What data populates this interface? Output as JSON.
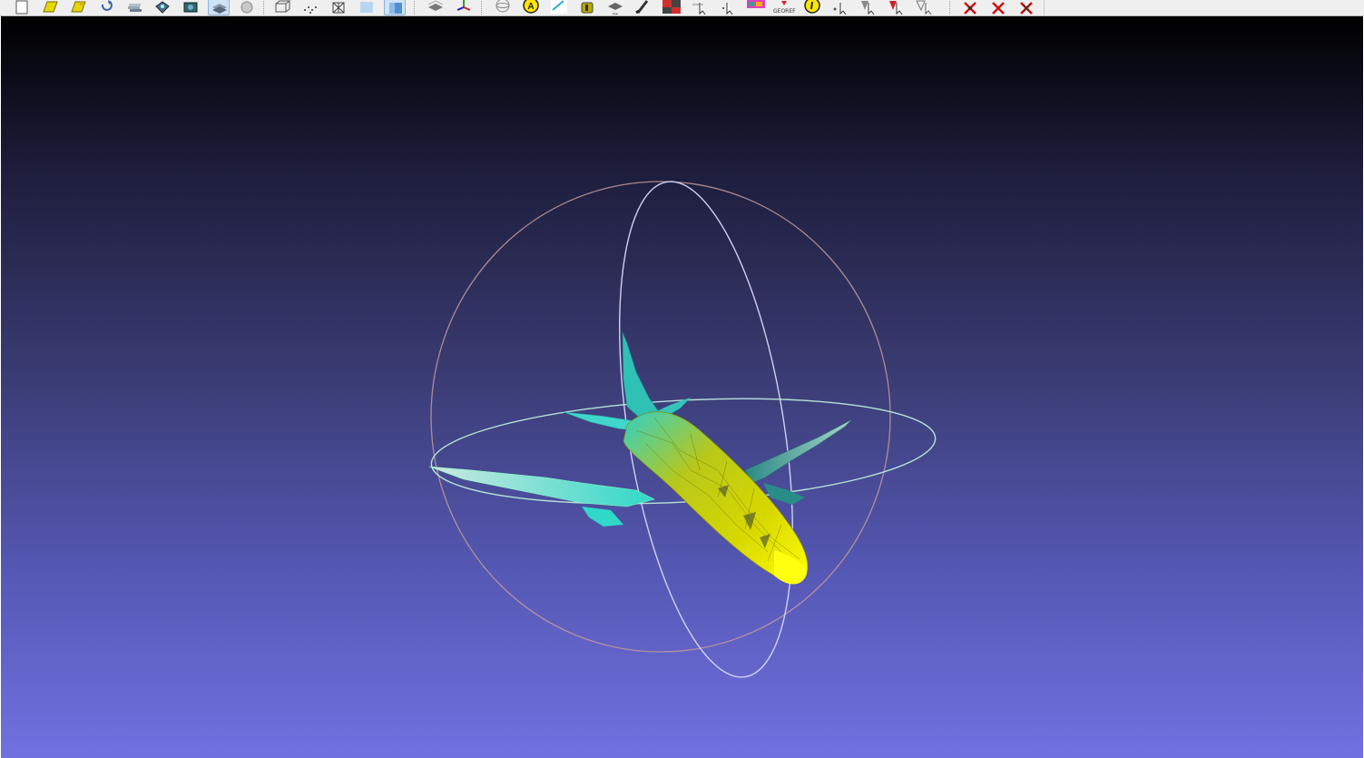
{
  "toolbar": {
    "groups": [
      {
        "id": "file",
        "icons": [
          "new-project-icon",
          "open-mesh-icon",
          "save-mesh-icon",
          "reload-icon",
          "layers-icon",
          "snapshot-icon",
          "render-icon",
          "layer-stack-icon",
          "sphere-light-icon"
        ]
      },
      {
        "id": "render",
        "icons": [
          "bounding-box-icon",
          "points-icon",
          "wireframe-icon",
          "flat-shading-icon",
          "smooth-shading-icon"
        ]
      },
      {
        "id": "transform",
        "icons": [
          "align-icon",
          "manipulator-icon"
        ]
      },
      {
        "id": "tools",
        "icons": [
          "trackball-icon",
          "annotation-icon",
          "measure-icon",
          "color-bucket-icon",
          "alignment-icon",
          "paint-brush-icon",
          "render-mode-icon",
          "pick-points-icon",
          "raster-icon",
          "georef-icon",
          "info-icon",
          "select-vertices-icon",
          "select-faces-icon",
          "select-connected-icon",
          "select-area-icon"
        ]
      },
      {
        "id": "delete",
        "icons": [
          "delete-vertices-icon",
          "delete-faces-icon",
          "delete-all-icon"
        ]
      }
    ],
    "georef_label": "GEOREF"
  },
  "viewport": {
    "background_top": "#000000",
    "background_bottom": "#7171e0",
    "trackball_colors": [
      "#c49a9a",
      "#d0d0f4",
      "#b8e4d8"
    ],
    "model_colors": [
      "#e8e800",
      "#2ad3c8",
      "#a4e2d0"
    ],
    "model_icon": "airplane-mesh"
  }
}
